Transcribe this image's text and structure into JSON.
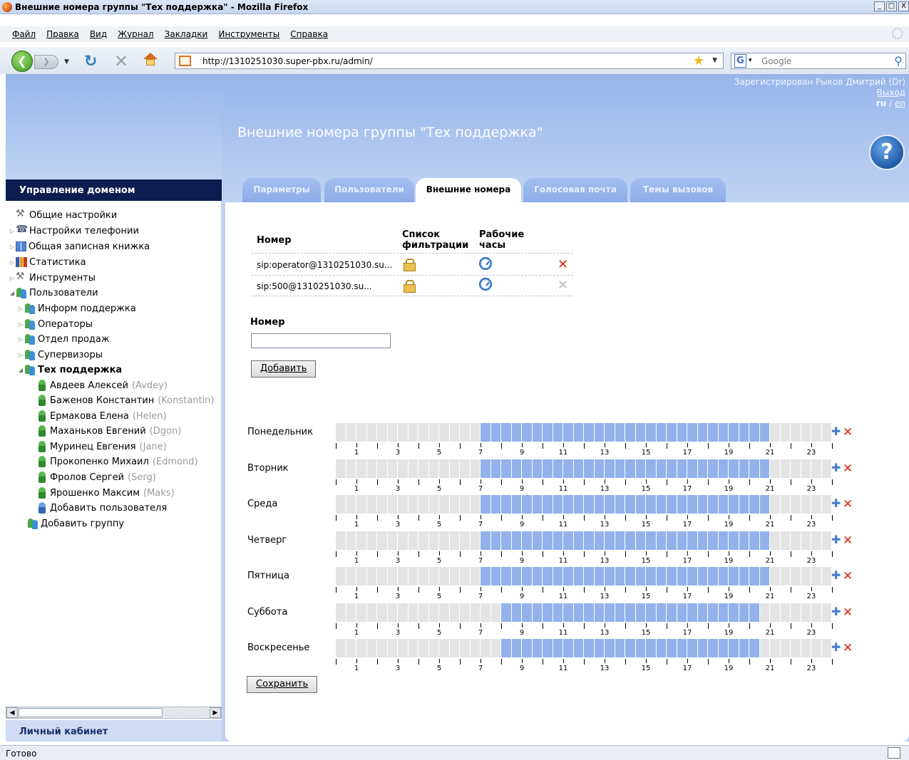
{
  "window": {
    "title": "Внешние номера группы \"Тех поддержка\" - Mozilla Firefox",
    "buttons": [
      "_",
      "□",
      "X"
    ]
  },
  "menu": [
    "Файл",
    "Правка",
    "Вид",
    "Журнал",
    "Закладки",
    "Инструменты",
    "Справка"
  ],
  "nav": {
    "url": "http://1310251030.super-pbx.ru/admin/",
    "search_engine": "G",
    "search_placeholder": "Google"
  },
  "left": {
    "title": "Управление доменом",
    "items": [
      {
        "label": "Общие настройки",
        "icon": "tools-icon"
      },
      {
        "label": "Настройки телефонии",
        "icon": "phone-settings-icon"
      },
      {
        "label": "Общая записная книжка",
        "icon": "address-book-icon"
      },
      {
        "label": "Статистика",
        "icon": "statistics-icon"
      },
      {
        "label": "Инструменты",
        "icon": "tools-icon"
      },
      {
        "label": "Пользователи",
        "icon": "users-group-icon"
      }
    ],
    "groups": [
      "Информ поддержка",
      "Операторы",
      "Отдел продаж",
      "Супервизоры",
      "Тех поддержка"
    ],
    "users": [
      {
        "name": "Авдеев Алексей",
        "nick": "(Avdey)"
      },
      {
        "name": "Баженов Константин",
        "nick": "(Konstantin)"
      },
      {
        "name": "Ермакова Елена",
        "nick": "(Helen)"
      },
      {
        "name": "Маханьков Евгений",
        "nick": "(Dgon)"
      },
      {
        "name": "Муринец Евгения",
        "nick": "(Jane)"
      },
      {
        "name": "Прокопенко Михаил",
        "nick": "(Edmond)"
      },
      {
        "name": "Фролов Сергей",
        "nick": "(Serg)"
      },
      {
        "name": "Ярошенко Максим",
        "nick": "(Maks)"
      }
    ],
    "add_user": "Добавить пользователя",
    "add_group": "Добавить группу",
    "cabinet": "Личный кабинет"
  },
  "header": {
    "registered": "Зарегистрирован Рыков Дмитрий (Dr)",
    "logout": "Выход",
    "lang_ru": "ru",
    "lang_sep": "/",
    "lang_en": "en",
    "page_title": "Внешние номера группы \"Тех поддержка\"",
    "help": "?"
  },
  "tabs": [
    {
      "label": "Параметры",
      "active": false
    },
    {
      "label": "Пользователи",
      "active": false
    },
    {
      "label": "Внешние номера",
      "active": true
    },
    {
      "label": "Голосовая почта",
      "active": false
    },
    {
      "label": "Темы вызовов",
      "active": false
    }
  ],
  "numbers": {
    "col_number": "Номер",
    "col_filter_1": "Список",
    "col_filter_2": "фильтрации",
    "col_hours_1": "Рабочие",
    "col_hours_2": "часы",
    "rows": [
      {
        "number": "sip:operator@1310251030.su...",
        "delete_color": "#e02412"
      },
      {
        "number": "sip:500@1310251030.su...",
        "delete_color": "#b9bec6"
      }
    ],
    "add_label": "Номер",
    "add_value": "",
    "add_button": "Добавить"
  },
  "schedule": {
    "hour_labels": [
      "1",
      "3",
      "5",
      "7",
      "9",
      "11",
      "13",
      "15",
      "17",
      "19",
      "21",
      "23"
    ],
    "days": [
      {
        "name": "Понедельник",
        "from": 7,
        "to": 21
      },
      {
        "name": "Вторник",
        "from": 7,
        "to": 21
      },
      {
        "name": "Среда",
        "from": 7,
        "to": 21
      },
      {
        "name": "Четверг",
        "from": 7,
        "to": 21
      },
      {
        "name": "Пятница",
        "from": 7,
        "to": 21
      },
      {
        "name": "Суббота",
        "from": 8,
        "to": 20.5
      },
      {
        "name": "Воскресенье",
        "from": 8,
        "to": 20.5
      }
    ],
    "save_button": "Сохранить"
  },
  "status": {
    "text": "Готово"
  },
  "colors": {
    "accent": "#93b2ec",
    "dark_nav": "#0d1d4f",
    "delete": "#e02412"
  }
}
